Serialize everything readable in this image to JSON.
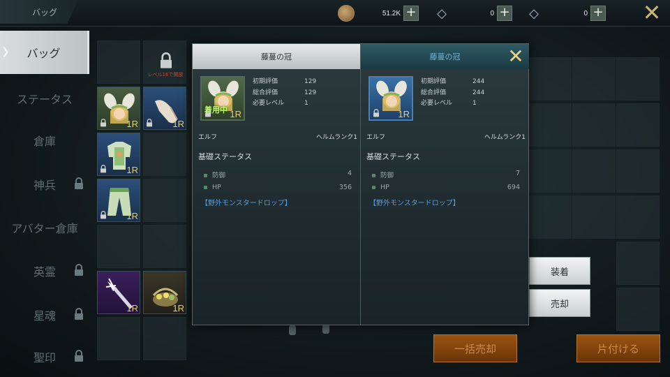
{
  "window": {
    "title": "バッグ"
  },
  "currency": {
    "gold": {
      "value": "51.2K"
    },
    "gem1": {
      "value": "0"
    },
    "gem2": {
      "value": "0"
    }
  },
  "sidebar": {
    "items": [
      {
        "label": "バッグ",
        "active": true,
        "locked": false
      },
      {
        "label": "ステータス",
        "active": false,
        "locked": false
      },
      {
        "label": "倉庫",
        "active": false,
        "locked": false
      },
      {
        "label": "神兵",
        "active": false,
        "locked": true
      },
      {
        "label": "アバター倉庫",
        "active": false,
        "locked": false
      },
      {
        "label": "英霊",
        "active": false,
        "locked": true
      },
      {
        "label": "星魂",
        "active": false,
        "locked": true
      },
      {
        "label": "聖印",
        "active": false,
        "locked": true
      }
    ]
  },
  "grid": {
    "locked_slot_text": "レベル16で開放",
    "rank_label": "1R"
  },
  "compare": {
    "left": {
      "name": "藤蔓の冠",
      "equipped_label": "着用中",
      "rank": "1R",
      "initial_eval_label": "初期評価",
      "initial_eval": "129",
      "total_eval_label": "総合評価",
      "total_eval": "129",
      "req_level_label": "必要レベル",
      "req_level": "1",
      "race": "エルフ",
      "type": "ヘルムランク1",
      "section": "基礎ステータス",
      "stats": [
        {
          "label": "防御",
          "value": "4"
        },
        {
          "label": "HP",
          "value": "356"
        }
      ],
      "source": "【野外モンスタードロップ】"
    },
    "right": {
      "name": "藤蔓の冠",
      "rank": "1R",
      "initial_eval_label": "初期評価",
      "initial_eval": "244",
      "total_eval_label": "総合評価",
      "total_eval": "244",
      "req_level_label": "必要レベル",
      "req_level": "1",
      "race": "エルフ",
      "type": "ヘルムランク1",
      "section": "基礎ステータス",
      "stats": [
        {
          "label": "防御",
          "value": "7"
        },
        {
          "label": "HP",
          "value": "694"
        }
      ],
      "source": "【野外モンスタードロップ】"
    }
  },
  "actions": {
    "equip": "装着",
    "sell": "売却",
    "bulk_sell": "一括売却",
    "tidy": "片付ける"
  },
  "colors": {
    "accent_gold": "#e8d28a",
    "rank_yellow": "#e0d070",
    "source_blue": "#4fa0e6",
    "equipped_green": "#b8ff60"
  }
}
